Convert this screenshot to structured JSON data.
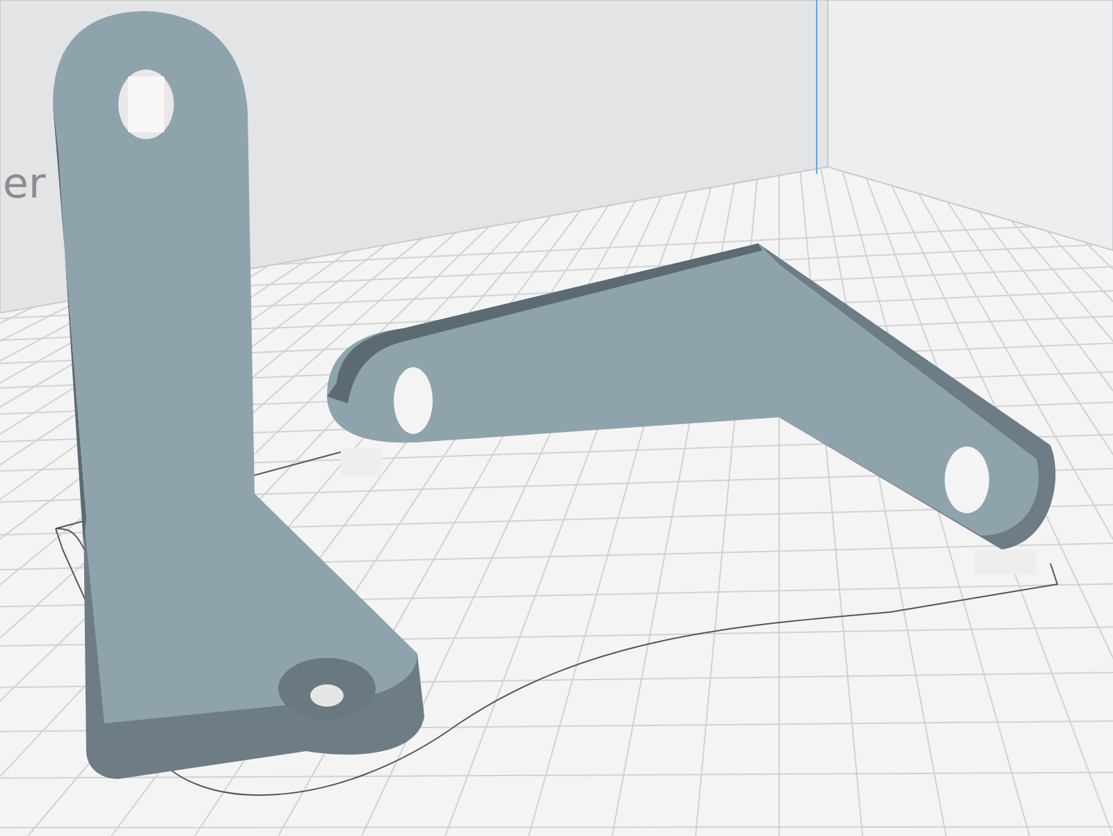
{
  "viewport": {
    "wall_label": "er"
  }
}
